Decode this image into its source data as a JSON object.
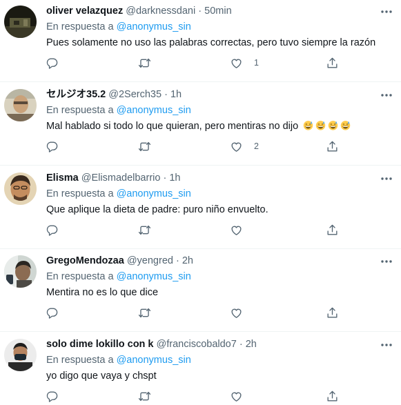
{
  "replying_label": "En respuesta a",
  "tweets": [
    {
      "name": "oliver velazquez",
      "handle": "@darknessdani",
      "dot": "·",
      "time": "50min",
      "reply_to": "@anonymus_sin",
      "text": "Pues solamente no uso las palabras correctas, pero tuvo siempre la razón",
      "likes": "1",
      "avatar_colors": [
        "#1a1a12",
        "#5b5a3c"
      ]
    },
    {
      "name": "セルジオ35.2",
      "handle": "@2Serch35",
      "dot": "·",
      "time": "1h",
      "reply_to": "@anonymus_sin",
      "text": "Mal hablado si todo lo que quieran, pero mentiras no dijo",
      "emoji": [
        "grinning-sweat-emoji",
        "grinning-sweat-emoji",
        "grinning-sweat-emoji",
        "grinning-sweat-emoji"
      ],
      "likes": "2",
      "avatar_colors": [
        "#d7c9a8",
        "#8a6b4a"
      ]
    },
    {
      "name": "Elisma",
      "handle": "@Elismadelbarrio",
      "dot": "·",
      "time": "1h",
      "reply_to": "@anonymus_sin",
      "text": "Que aplique la dieta de padre: puro niño envuelto.",
      "likes": "",
      "avatar_colors": [
        "#e8d3a9",
        "#6b4a2e"
      ]
    },
    {
      "name": "GregoMendozaa",
      "handle": "@yengred",
      "dot": "·",
      "time": "2h",
      "reply_to": "@anonymus_sin",
      "text": "Mentira no es lo que dice",
      "likes": "",
      "avatar_colors": [
        "#cfd6d2",
        "#4d4a45"
      ]
    },
    {
      "name": "solo dime lokillo con k",
      "handle": "@franciscobaldo7",
      "dot": "·",
      "time": "2h",
      "reply_to": "@anonymus_sin",
      "text": "yo digo que vaya y chspt",
      "likes": "",
      "avatar_colors": [
        "#e9e9e9",
        "#2a2a2a"
      ]
    }
  ],
  "icons": {
    "reply": "reply-icon",
    "retweet": "retweet-icon",
    "like": "heart-icon",
    "share": "share-icon",
    "more": "more-icon"
  },
  "colors": {
    "text": "#0f1419",
    "secondary": "#536471",
    "accent": "#1d9bf0",
    "divider": "#eff3f4"
  }
}
